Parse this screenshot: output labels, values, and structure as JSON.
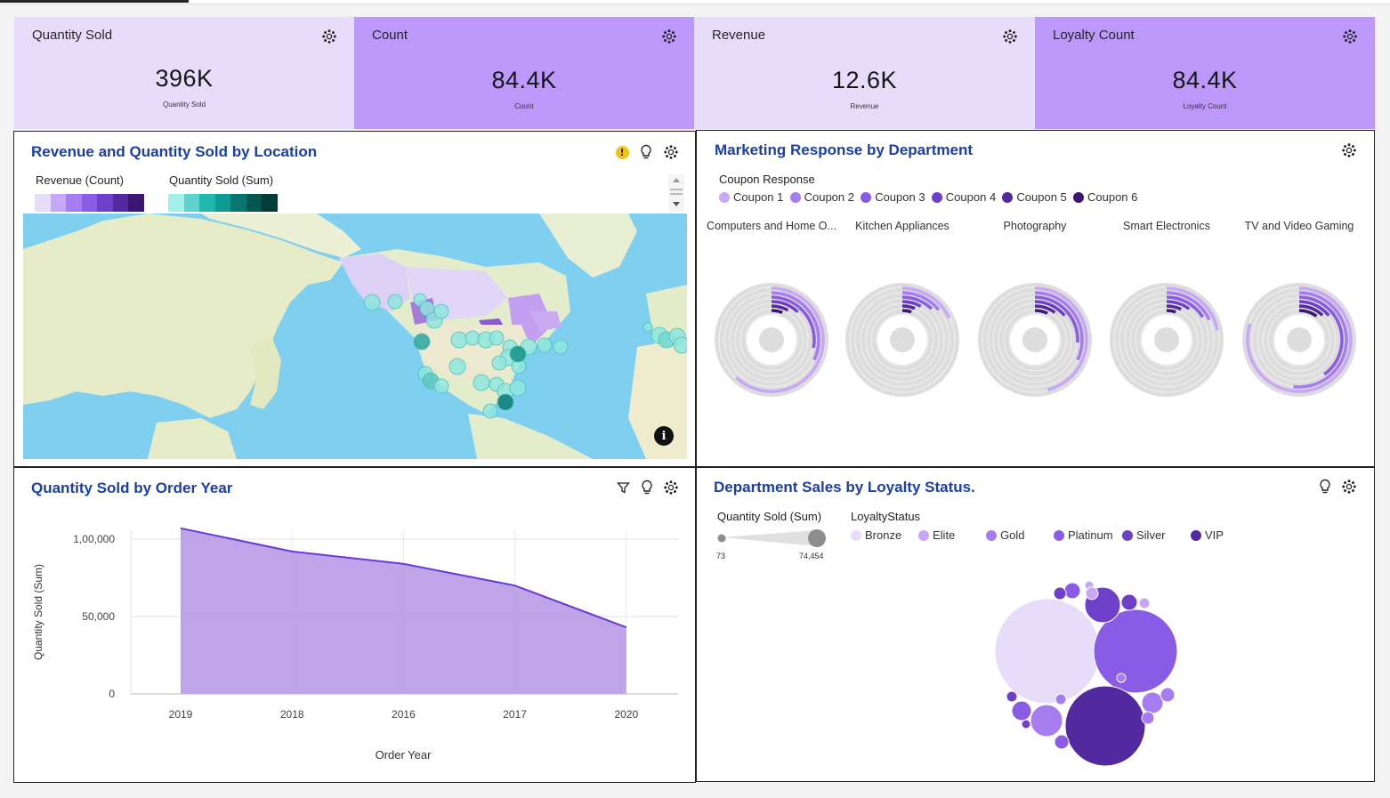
{
  "kpis": [
    {
      "title": "Quantity Sold",
      "value": "396K",
      "sub": "Quantity Sold",
      "bg": "#e8dcfb"
    },
    {
      "title": "Count",
      "value": "84.4K",
      "sub": "Count",
      "bg": "#bb98f9"
    },
    {
      "title": "Revenue",
      "value": "12.6K",
      "sub": "Revenue",
      "bg": "#e8dcfb"
    },
    {
      "title": "Loyalty Count",
      "value": "84.4K",
      "sub": "Loyalty Count",
      "bg": "#bb98f9"
    }
  ],
  "map_panel": {
    "title": "Revenue and Quantity Sold by Location",
    "legend_revenue": "Revenue (Count)",
    "legend_quantity": "Quantity Sold (Sum)",
    "revenue_colors": [
      "#e8dcfb",
      "#c7a8f6",
      "#a57df0",
      "#8a5ce6",
      "#6e3fc9",
      "#53299f",
      "#3b1673"
    ],
    "quantity_colors": [
      "#a2f0ea",
      "#5fd3cb",
      "#20b7ad",
      "#0e9b93",
      "#08766f",
      "#045751",
      "#013c37"
    ],
    "warning_icon": "!"
  },
  "marketing_panel": {
    "title": "Marketing Response by Department",
    "legend_title": "Coupon Response",
    "legend": [
      {
        "name": "Coupon 1",
        "color": "#c7a8f6"
      },
      {
        "name": "Coupon 2",
        "color": "#a57df0"
      },
      {
        "name": "Coupon 3",
        "color": "#8a5ce6"
      },
      {
        "name": "Coupon 4",
        "color": "#6e3fc9"
      },
      {
        "name": "Coupon 5",
        "color": "#53299f"
      },
      {
        "name": "Coupon 6",
        "color": "#3b1673"
      }
    ],
    "departments": [
      "Computers and Home O...",
      "Kitchen Appliances",
      "Photography",
      "Smart Electronics",
      "TV and Video Gaming"
    ]
  },
  "quantity_panel": {
    "title": "Quantity Sold by Order Year",
    "ylabel": "Quantity Sold (Sum)",
    "xlabel": "Order Year"
  },
  "loyalty_panel": {
    "title": "Department Sales by Loyalty Status.",
    "size_legend_title": "Quantity Sold (Sum)",
    "size_min": "73",
    "size_max": "74,454",
    "color_legend_title": "LoyaltyStatus",
    "legend": [
      {
        "name": "Bronze",
        "color": "#e8dcfb"
      },
      {
        "name": "Elite",
        "color": "#c7a8f6"
      },
      {
        "name": "Gold",
        "color": "#a57df0"
      },
      {
        "name": "Platinum",
        "color": "#8a5ce6"
      },
      {
        "name": "Silver",
        "color": "#6e3fc9"
      },
      {
        "name": "VIP",
        "color": "#53299f"
      }
    ]
  },
  "chart_data": [
    {
      "type": "area",
      "title": "Quantity Sold by Order Year",
      "xlabel": "Order Year",
      "ylabel": "Quantity Sold (Sum)",
      "categories": [
        "2019",
        "2018",
        "2016",
        "2017",
        "2020"
      ],
      "values": [
        107000,
        92000,
        84000,
        70000,
        43000
      ],
      "ylim": [
        0,
        100000
      ],
      "yticks": [
        "0",
        "50,000",
        "1,00,000"
      ],
      "color": "#b594e6",
      "line_color": "#6c3ad0",
      "grid": true
    }
  ]
}
